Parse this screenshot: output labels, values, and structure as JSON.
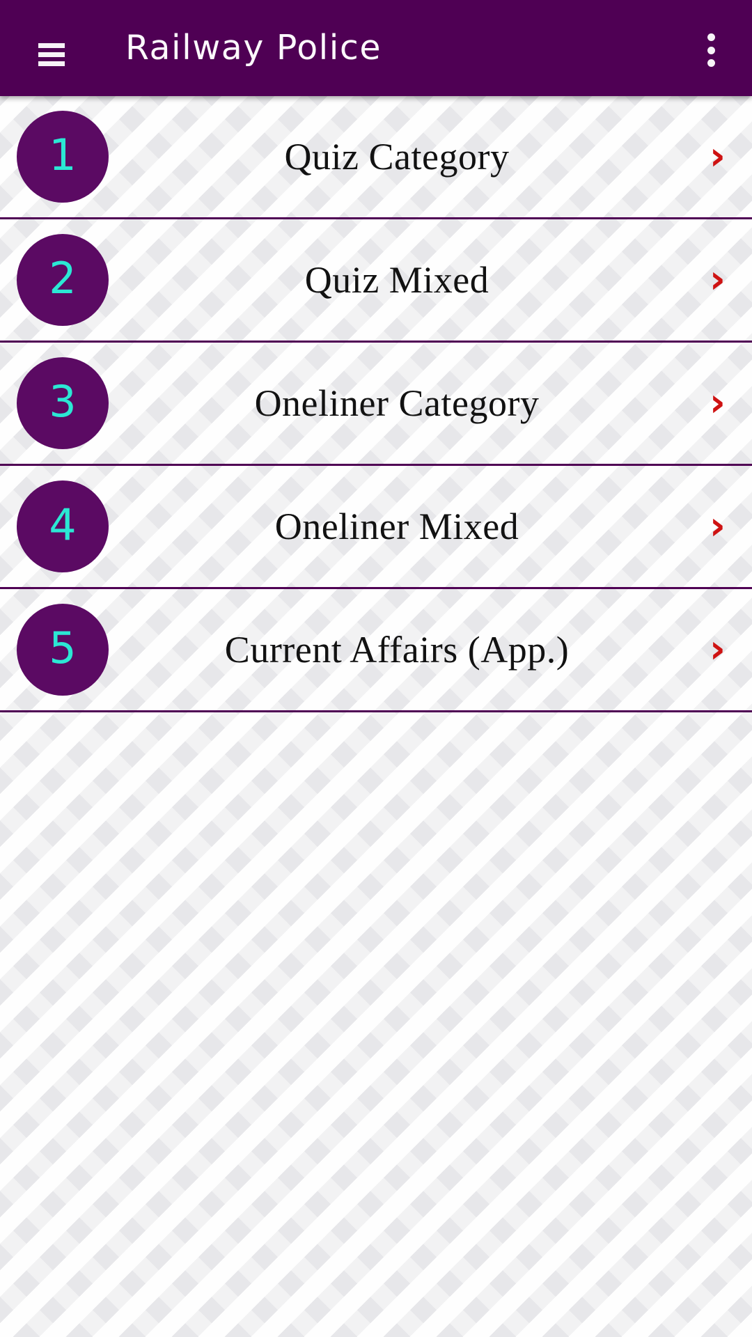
{
  "app": {
    "title": "Railway Police",
    "accent_purple": "#4F0054",
    "badge_purple": "#5B0A63",
    "badge_number_color": "#2BE8D4",
    "chevron_color": "#CE1212",
    "background_color": "#f2f2f3"
  },
  "appbar": {
    "menu_icon": "hamburger-menu-icon",
    "title": "Railway Police",
    "overflow_icon": "more-vertical-icon"
  },
  "list": {
    "items": [
      {
        "number": "1",
        "label": "Quiz Category",
        "chevron": "›"
      },
      {
        "number": "2",
        "label": "Quiz Mixed",
        "chevron": "›"
      },
      {
        "number": "3",
        "label": "Oneliner Category",
        "chevron": "›"
      },
      {
        "number": "4",
        "label": "Oneliner Mixed",
        "chevron": "›"
      },
      {
        "number": "5",
        "label": "Current Affairs (App.)",
        "chevron": "›"
      }
    ]
  }
}
